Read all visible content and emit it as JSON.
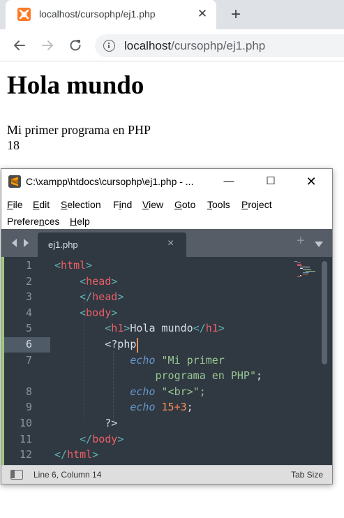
{
  "browser": {
    "tab_title": "localhost/cursophp/ej1.php",
    "tab_close": "✕",
    "new_tab": "+",
    "url_host": "localhost",
    "url_path": "/cursophp/ej1.php",
    "icons": [
      "xampp-favicon",
      "back-arrow-icon",
      "forward-arrow-icon",
      "reload-icon",
      "info-icon"
    ]
  },
  "page": {
    "heading": "Hola mundo",
    "line1": "Mi primer programa en PHP",
    "line2": "18"
  },
  "editor_window": {
    "title": "C:\\xampp\\htdocs\\cursophp\\ej1.php - ...",
    "controls": {
      "minimize": "—",
      "maximize": "☐",
      "close": "✕"
    },
    "menu": [
      {
        "label": "File",
        "mnemonic": "F",
        "rest": "ile"
      },
      {
        "label": "Edit",
        "mnemonic": "E",
        "rest": "dit"
      },
      {
        "label": "Selection",
        "mnemonic": "S",
        "rest": "election"
      },
      {
        "label": "Find",
        "pre": "F",
        "mnemonic": "i",
        "rest": "nd"
      },
      {
        "label": "View",
        "mnemonic": "V",
        "rest": "iew"
      },
      {
        "label": "Goto",
        "mnemonic": "G",
        "rest": "oto"
      },
      {
        "label": "Tools",
        "mnemonic": "T",
        "rest": "ools"
      },
      {
        "label": "Project",
        "mnemonic": "P",
        "rest": "roject"
      },
      {
        "label": "Preferences",
        "pre": "Prefere",
        "mnemonic": "n",
        "rest": "ces"
      },
      {
        "label": "Help",
        "mnemonic": "H",
        "rest": "elp"
      }
    ],
    "tab": {
      "label": "ej1.php",
      "close": "×"
    },
    "tab_plus": "+",
    "line_numbers": [
      "1",
      "2",
      "3",
      "4",
      "5",
      "6",
      "7",
      "",
      "8",
      "9",
      "10",
      "11",
      "12"
    ],
    "active_line": "6",
    "code": [
      "<html>",
      "    <head>",
      "    </head>",
      "    <body>",
      "        <h1>Hola mundo</h1>",
      "        <?php",
      "            echo \"Mi primer",
      "                programa en PHP\";",
      "            echo \"<br>\";",
      "            echo 15+3;",
      "        ?>",
      "    </body>",
      "</html>"
    ],
    "colors": {
      "background": "#303841",
      "tag_punctuation": "#5fb3b3",
      "tag_name": "#ec5f67",
      "keyword": "#6699cc",
      "string": "#99c794",
      "number": "#f99157",
      "text": "#d8dee9",
      "git_added": "#a0c980"
    },
    "status": {
      "position": "Line 6, Column 14",
      "tab_size": "Tab Size"
    }
  }
}
